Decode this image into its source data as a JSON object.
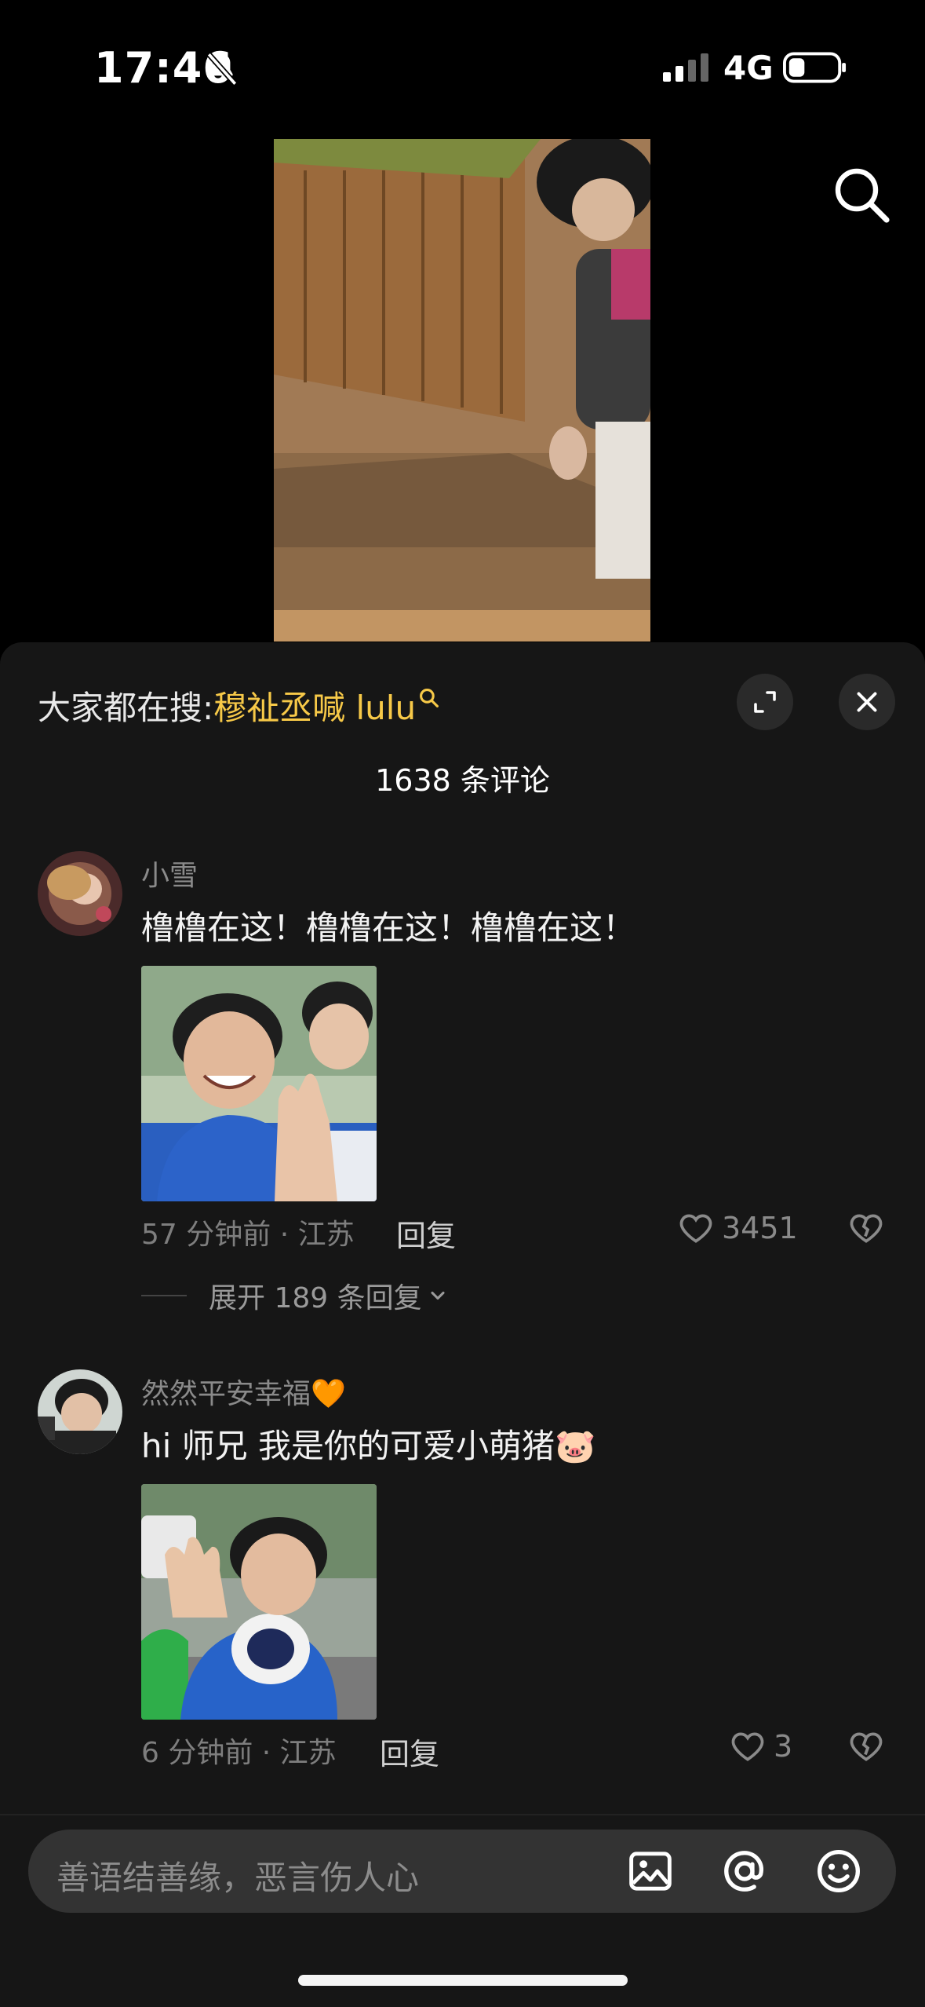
{
  "status_bar": {
    "time": "17:46",
    "network": "4G",
    "icons": [
      "bell-muted-icon",
      "signal-icon",
      "battery-icon"
    ]
  },
  "video": {
    "icons": [
      "search-icon"
    ]
  },
  "comments_panel": {
    "suggest_label": "大家都在搜:",
    "suggest_keyword": "穆祉丞喊 lulu",
    "comment_count_title": "1638 条评论",
    "comments": [
      {
        "username": "小雪",
        "text": "橹橹在这！橹橹在这！橹橹在这！",
        "meta": "57 分钟前 · 江苏",
        "reply_label": "回复",
        "likes": "3451",
        "expand_label": "展开 189 条回复"
      },
      {
        "username": "然然平安幸福🧡",
        "text": "hi 师兄 我是你的可爱小萌猪🐷",
        "meta": "6 分钟前 · 江苏",
        "reply_label": "回复",
        "likes": "3"
      }
    ]
  },
  "input_bar": {
    "placeholder": "善语结善缘，恶言伤人心",
    "icons": [
      "image-icon",
      "at-icon",
      "emoji-icon"
    ]
  },
  "colors": {
    "accent_keyword": "#f7c948",
    "sheet_bg": "#161616",
    "input_bg": "#333333"
  }
}
